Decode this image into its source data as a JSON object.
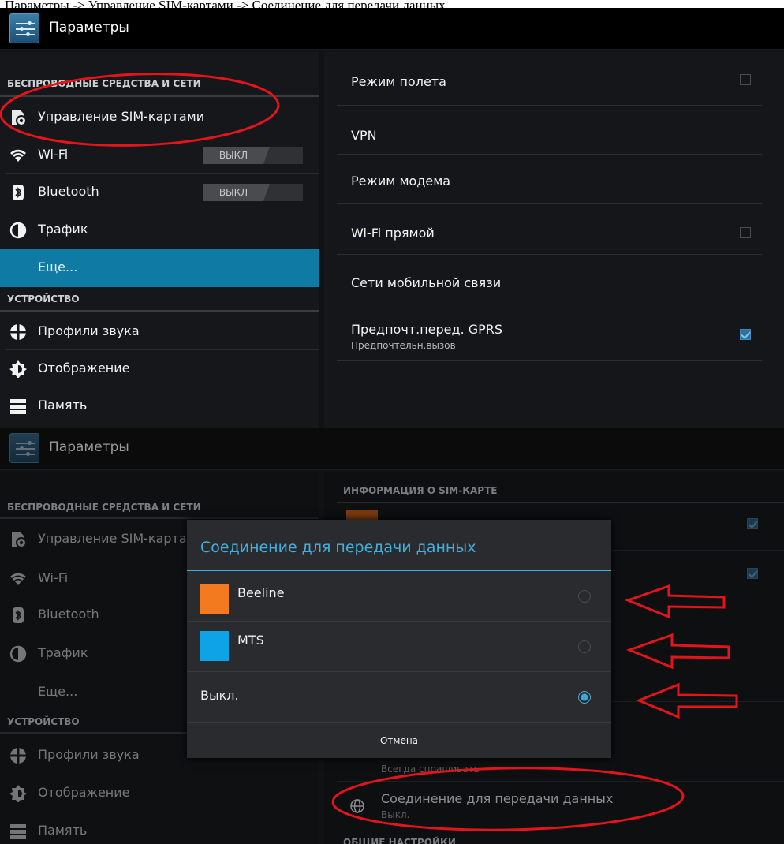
{
  "caption": "Параметры -> Управление SIM-картами -> Соединение для передачи данных.",
  "top": {
    "app_title": "Параметры",
    "section_wireless": "БЕСПРОВОДНЫЕ СРЕДСТВА И СЕТИ",
    "section_device": "УСТРОЙСТВО",
    "menu": {
      "sim": "Управление SIM-картами",
      "wifi": "Wi-Fi",
      "bluetooth": "Bluetooth",
      "traffic": "Трафик",
      "more": "Еще...",
      "sound": "Профили звука",
      "display": "Отображение",
      "memory": "Память"
    },
    "toggle_off": "ВЫКЛ",
    "right": {
      "airplane": "Режим полета",
      "vpn": "VPN",
      "modem": "Режим модема",
      "wifi_direct": "Wi-Fi прямой",
      "mobile_networks": "Сети мобильной связи",
      "gprs_pref": "Предпочт.перед. GPRS",
      "gprs_pref_sub": "Предпочтельн.вызов"
    }
  },
  "bottom": {
    "app_title": "Параметры",
    "sim_info_header": "ИНФОРМАЦИЯ О SIM-КАРТЕ",
    "ask_always": "Всегда спрашивать",
    "data_conn": "Соединение для передачи данных",
    "data_conn_sub": "Выкл.",
    "general_header": "ОБЩИЕ НАСТРОЙКИ",
    "dialog": {
      "title": "Соединение для передачи данных",
      "opt1": "Beeline",
      "opt2": "MTS",
      "opt3": "Выкл.",
      "cancel": "Отмена"
    }
  },
  "colors": {
    "accent": "#33b5e5",
    "selected": "#0f7ba5",
    "beeline": "#f47a1f",
    "mts": "#0ea3e4",
    "annotation": "#e3141b"
  }
}
